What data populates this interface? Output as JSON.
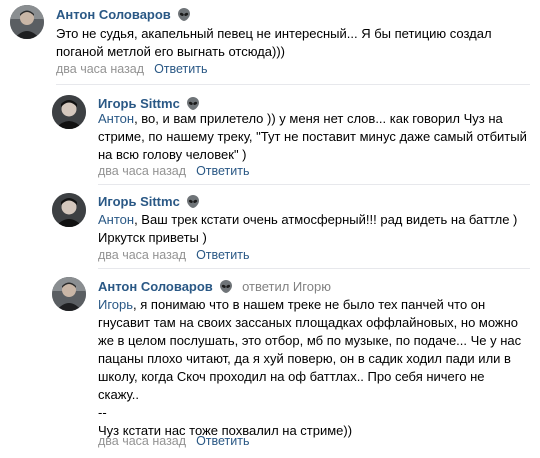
{
  "comments": [
    {
      "author": "Антон Соловаров",
      "replied_to": "",
      "mention": "",
      "text": "Это не судья, акапельный певец не интересный... Я бы петицию создал\nпоганой метлой его выгнать отсюда)))",
      "time": "два часа назад",
      "reply_label": "Ответить",
      "avatar_icon": "person-photo-icon",
      "badge_icon": "alien-icon"
    },
    {
      "author": "Игорь Sittmc",
      "replied_to": "",
      "mention": "Антон",
      "text": ", во, и вам прилетело )) у меня нет слов... как говорил Чуз на\nстриме, по нашему треку, \"Тут не поставит минус даже самый отбитый\nна всю голову человек\" )",
      "time": "два часа назад",
      "reply_label": "Ответить",
      "avatar_icon": "person-photo-icon",
      "badge_icon": "alien-icon"
    },
    {
      "author": "Игорь Sittmc",
      "replied_to": "",
      "mention": "Антон",
      "text": ", Ваш трек кстати очень атмосферный!!! рад видеть на баттле )\nИркутск приветы )",
      "time": "два часа назад",
      "reply_label": "Ответить",
      "avatar_icon": "person-photo-icon",
      "badge_icon": "alien-icon"
    },
    {
      "author": "Антон Соловаров",
      "replied_to": "ответил Игорю",
      "mention": "Игорь",
      "text": ", я понимаю что в нашем треке не было тех панчей что он\nгнусавит там на своих зассаных площадках оффлайновых, но можно\nже в целом послушать, это отбор, мб по музыке, по подаче... Че у нас\nпацаны плохо читают, да я хуй поверю, он в садик ходил пади или в\nшколу, когда Скоч проходил на оф баттлах.. Про себя ничего не\nскажу..\n--\nЧуз кстати нас тоже похвалил на стриме))",
      "time": "два часа назад",
      "reply_label": "Ответить",
      "avatar_icon": "person-photo-icon",
      "badge_icon": "alien-icon"
    }
  ],
  "colors": {
    "link": "#2a5885",
    "muted": "#939393",
    "divider": "#e7e8ec"
  }
}
